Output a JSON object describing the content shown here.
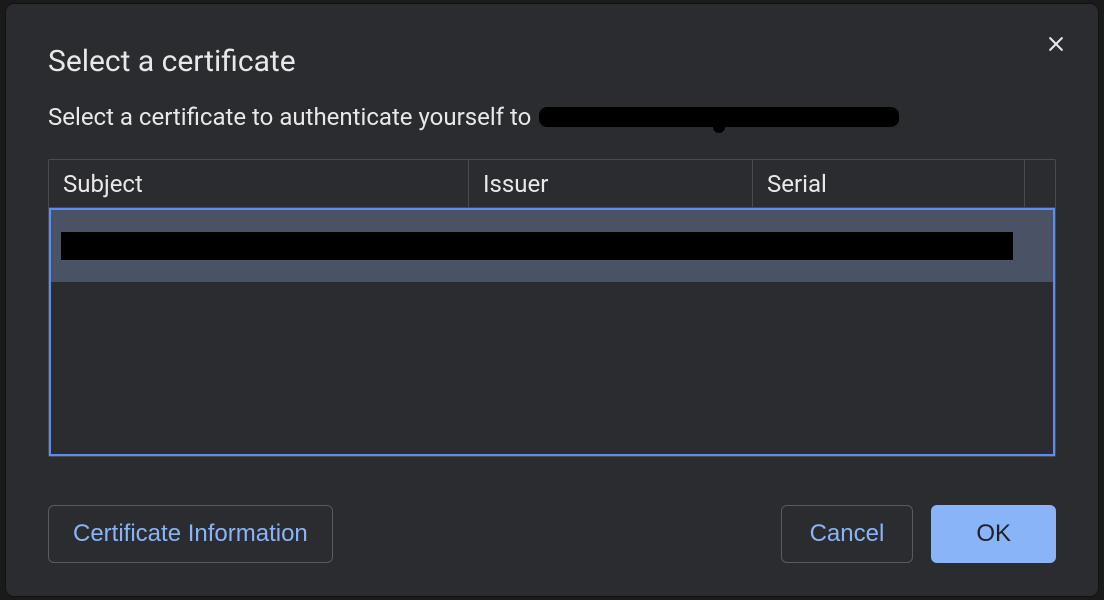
{
  "dialog": {
    "title": "Select a certificate",
    "subtitle_prefix": "Select a certificate to authenticate yourself to",
    "host_redacted": true
  },
  "table": {
    "headers": {
      "subject": "Subject",
      "issuer": "Issuer",
      "serial": "Serial"
    },
    "rows": [
      {
        "subject_redacted": true,
        "issuer_redacted": true,
        "serial_redacted": true
      }
    ]
  },
  "buttons": {
    "cert_info": "Certificate Information",
    "cancel": "Cancel",
    "ok": "OK"
  }
}
